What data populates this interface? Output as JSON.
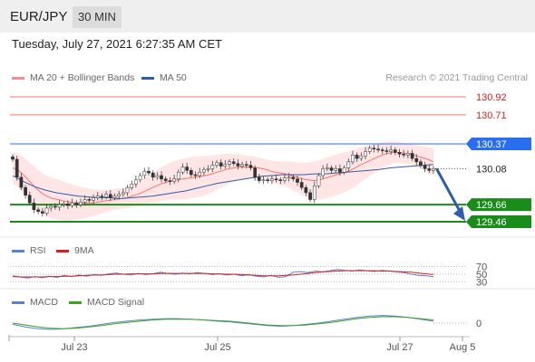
{
  "header": {
    "pair": "EUR/JPY",
    "timeframe": "30 MIN"
  },
  "datetime": "Tuesday, July 27, 2021 6:27:35 AM CET",
  "legend": {
    "ma20": "MA 20 + Bollinger Bands",
    "ma50": "MA 50",
    "copyright": "Research © 2021 Trading Central",
    "rsi": "RSI",
    "rsi_ma": "9MA",
    "macd": "MACD",
    "macd_signal": "MACD Signal"
  },
  "colors": {
    "ma20": "#ff6f6f",
    "ma50": "#2f5ea8",
    "bollinger_band": "#ffdcdc",
    "resistance": "#ff6f6f",
    "pivot": "#2a6ef0",
    "support": "#1a8c1a",
    "candle_up": "#1a8c1a",
    "candle_down": "#e02020",
    "rsi": "#5b7fd6",
    "rsi_ma": "#d81e1e",
    "macd": "#5b7fd6",
    "macd_signal": "#3aa61f",
    "arrow": "#2f5ea8"
  },
  "chart_data": [
    {
      "type": "candlestick",
      "title": "EUR/JPY 30 MIN",
      "x_ticks": [
        "Jul 23",
        "Jul 25",
        "Jul 27",
        "Aug 5"
      ],
      "ylim": [
        129.35,
        131.0
      ],
      "levels": [
        {
          "label": "130.92",
          "value": 130.92,
          "kind": "resistance"
        },
        {
          "label": "130.71",
          "value": 130.71,
          "kind": "resistance"
        },
        {
          "label": "130.37",
          "value": 130.37,
          "kind": "pivot"
        },
        {
          "label": "130.08",
          "value": 130.08,
          "kind": "last"
        },
        {
          "label": "129.66",
          "value": 129.66,
          "kind": "support"
        },
        {
          "label": "129.46",
          "value": 129.46,
          "kind": "support"
        }
      ],
      "close_series": [
        130.19,
        129.98,
        129.86,
        129.77,
        129.68,
        129.6,
        129.58,
        129.56,
        129.62,
        129.64,
        129.63,
        129.66,
        129.67,
        129.65,
        129.68,
        129.66,
        129.69,
        129.72,
        129.71,
        129.74,
        129.76,
        129.75,
        129.78,
        129.74,
        129.76,
        129.78,
        129.8,
        129.86,
        129.9,
        129.95,
        130.0,
        130.05,
        130.03,
        129.98,
        130.0,
        129.96,
        129.94,
        129.93,
        129.96,
        130.04,
        130.1,
        130.06,
        130.01,
        130.0,
        130.04,
        130.07,
        130.08,
        130.12,
        130.15,
        130.11,
        130.13,
        130.16,
        130.14,
        130.11,
        130.13,
        130.12,
        130.09,
        129.98,
        129.94,
        129.95,
        129.94,
        129.96,
        129.95,
        129.94,
        129.97,
        129.98,
        129.96,
        129.92,
        129.86,
        129.8,
        129.72,
        129.88,
        130.0,
        130.08,
        130.09,
        130.06,
        130.08,
        130.04,
        130.09,
        130.16,
        130.24,
        130.2,
        130.23,
        130.28,
        130.32,
        130.31,
        130.3,
        130.29,
        130.28,
        130.3,
        130.27,
        130.25,
        130.24,
        130.26,
        130.2,
        130.16,
        130.12,
        130.08,
        130.06,
        130.08
      ],
      "ma20_series": [
        130.09,
        130.06,
        130.0,
        129.93,
        129.86,
        129.8,
        129.76,
        129.73,
        129.72,
        129.7,
        129.69,
        129.68,
        129.68,
        129.68,
        129.68,
        129.69,
        129.7,
        129.71,
        129.72,
        129.73,
        129.74,
        129.76,
        129.78,
        129.81,
        129.84,
        129.87,
        129.9,
        129.92,
        129.94,
        129.95,
        129.96,
        129.97,
        129.98,
        129.99,
        130.0,
        130.02,
        130.04,
        130.06,
        130.08,
        130.09,
        130.1,
        130.1,
        130.1,
        130.09,
        130.08,
        130.06,
        130.04,
        130.03,
        130.02,
        130.0,
        129.98,
        129.96,
        129.95,
        129.94,
        129.95,
        129.97,
        129.99,
        130.01,
        130.03,
        130.05,
        130.08,
        130.12,
        130.15,
        130.18,
        130.21,
        130.24,
        130.26,
        130.27,
        130.27,
        130.26,
        130.25,
        130.23,
        130.21,
        130.19,
        130.16
      ],
      "ma50_series": [
        130.0,
        129.93,
        129.87,
        129.83,
        129.8,
        129.78,
        129.76,
        129.75,
        129.74,
        129.74,
        129.73,
        129.74,
        129.75,
        129.76,
        129.78,
        129.8,
        129.82,
        129.85,
        129.88,
        129.91,
        129.93,
        129.95,
        129.97,
        129.99,
        130.0,
        130.01,
        130.01,
        130.01,
        130.02,
        130.02,
        130.03,
        130.04,
        130.05,
        130.06,
        130.07,
        130.09,
        130.1,
        130.11,
        130.12,
        130.13
      ],
      "forecast_target": 129.46
    },
    {
      "type": "line",
      "name": "RSI",
      "yticks": [
        "70",
        "50",
        "30"
      ],
      "ylim": [
        20,
        80
      ],
      "series": [
        {
          "name": "RSI",
          "values": [
            46,
            43,
            40,
            44,
            41,
            45,
            42,
            47,
            44,
            48,
            45,
            49,
            47,
            51,
            53,
            50,
            48,
            52,
            49,
            51,
            55,
            52,
            50,
            53,
            51,
            54,
            52,
            49,
            51,
            48,
            50,
            46,
            49,
            45,
            43,
            47,
            42,
            44,
            55,
            57,
            54,
            58,
            56,
            59,
            62,
            60,
            58,
            61,
            59,
            57,
            60,
            58,
            56,
            54,
            50,
            47,
            46,
            44
          ]
        },
        {
          "name": "9MA",
          "values": [
            44,
            43,
            43,
            43,
            43,
            44,
            44,
            45,
            45,
            46,
            47,
            48,
            48,
            49,
            50,
            50,
            51,
            51,
            51,
            51,
            52,
            52,
            52,
            52,
            52,
            52,
            52,
            51,
            51,
            50,
            50,
            49,
            48,
            47,
            46,
            46,
            46,
            47,
            48,
            50,
            52,
            54,
            56,
            57,
            58,
            59,
            59,
            59,
            59,
            59,
            58,
            58,
            57,
            56,
            55,
            53,
            51,
            49
          ]
        }
      ]
    },
    {
      "type": "line",
      "name": "MACD",
      "yticks": [
        "0"
      ],
      "series": [
        {
          "name": "MACD",
          "values": [
            -0.02,
            -0.06,
            -0.09,
            -0.1,
            -0.09,
            -0.07,
            -0.05,
            -0.02,
            0.01,
            0.03,
            0.05,
            0.06,
            0.07,
            0.07,
            0.06,
            0.05,
            0.03,
            0.02,
            0.0,
            -0.02,
            -0.04,
            -0.05,
            -0.04,
            -0.02,
            0.0,
            0.03,
            0.06,
            0.09,
            0.11,
            0.12,
            0.11,
            0.09,
            0.06,
            0.03
          ]
        },
        {
          "name": "MACD Signal",
          "values": [
            0.0,
            -0.03,
            -0.06,
            -0.08,
            -0.09,
            -0.08,
            -0.06,
            -0.04,
            -0.01,
            0.01,
            0.03,
            0.05,
            0.06,
            0.06,
            0.06,
            0.05,
            0.04,
            0.03,
            0.01,
            -0.01,
            -0.03,
            -0.04,
            -0.04,
            -0.03,
            -0.01,
            0.01,
            0.04,
            0.07,
            0.09,
            0.1,
            0.1,
            0.09,
            0.07,
            0.05
          ]
        }
      ]
    }
  ]
}
